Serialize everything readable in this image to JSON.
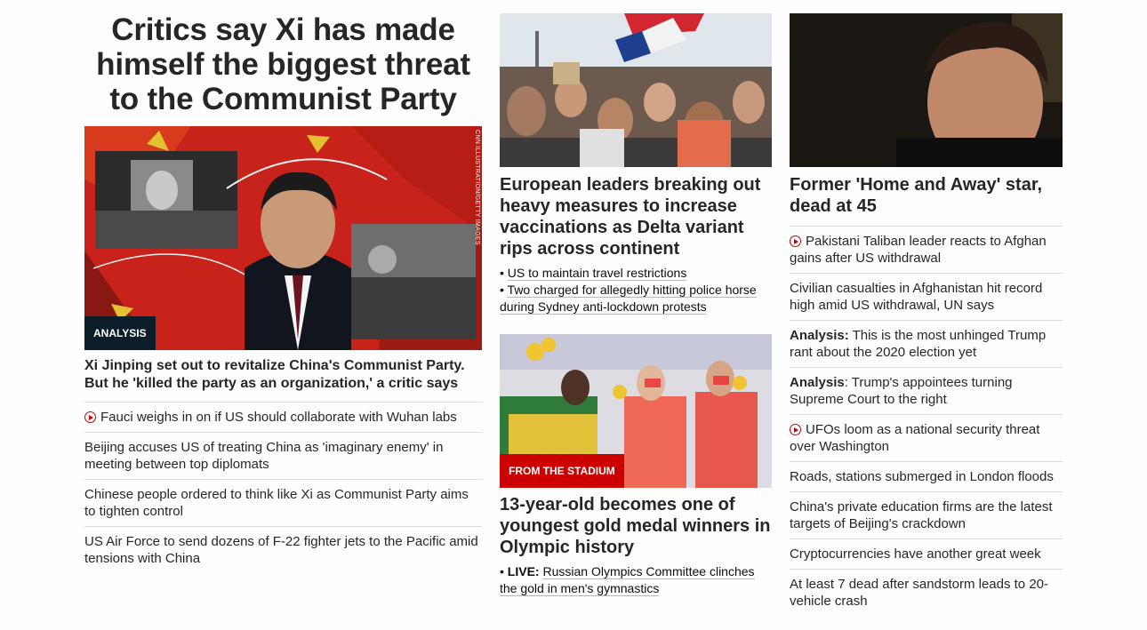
{
  "col1": {
    "headline": "Critics say Xi has made himself the biggest threat to the Communist Party",
    "image_credit": "CNN ILLUSTRATION/GETTY IMAGES",
    "badge": "ANALYSIS",
    "story_title": "Xi Jinping set out to revitalize China's Communist Party. But he 'killed the party as an organization,' a critic says",
    "links": [
      {
        "text": "Fauci weighs in on if US should collaborate with Wuhan labs",
        "video": true
      },
      {
        "text": "Beijing accuses US of treating China as 'imaginary enemy' in meeting between top diplomats",
        "video": false
      },
      {
        "text": "Chinese people ordered to think like Xi as Communist Party aims to tighten control",
        "video": false
      },
      {
        "text": "US Air Force to send dozens of F-22 fighter jets to the Pacific amid tensions with China",
        "video": false
      }
    ]
  },
  "col2": {
    "story1": {
      "title": "European leaders breaking out heavy measures to increase vaccinations as Delta variant rips across continent",
      "bullets": [
        "US to maintain travel restrictions",
        "Two charged for allegedly hitting police horse during Sydney anti-lockdown protests"
      ]
    },
    "story2": {
      "badge": "FROM THE STADIUM",
      "title": "13-year-old becomes one of youngest gold medal winners in Olympic history",
      "live_label": "LIVE:",
      "live_text": "Russian Olympics Committee clinches the gold in men's gymnastics"
    }
  },
  "col3": {
    "title": "Former 'Home and Away' star, dead at 45",
    "links": [
      {
        "prefix": "",
        "text": "Pakistani Taliban leader reacts to Afghan gains after US withdrawal",
        "video": true
      },
      {
        "prefix": "",
        "text": "Civilian casualties in Afghanistan hit record high amid US withdrawal, UN says",
        "video": false
      },
      {
        "prefix": "Analysis:",
        "text": " This is the most unhinged Trump rant about the 2020 election yet",
        "video": false
      },
      {
        "prefix": "Analysis",
        "text": ": Trump's appointees turning Supreme Court to the right",
        "video": false
      },
      {
        "prefix": "",
        "text": "UFOs loom as a national security threat over Washington",
        "video": true
      },
      {
        "prefix": "",
        "text": "Roads, stations submerged in London floods",
        "video": false
      },
      {
        "prefix": "",
        "text": "China's private education firms are the latest targets of Beijing's crackdown",
        "video": false
      },
      {
        "prefix": "",
        "text": "Cryptocurrencies have another great week",
        "video": false
      },
      {
        "prefix": "",
        "text": "At least 7 dead after sandstorm leads to 20-vehicle crash",
        "video": false
      }
    ]
  }
}
